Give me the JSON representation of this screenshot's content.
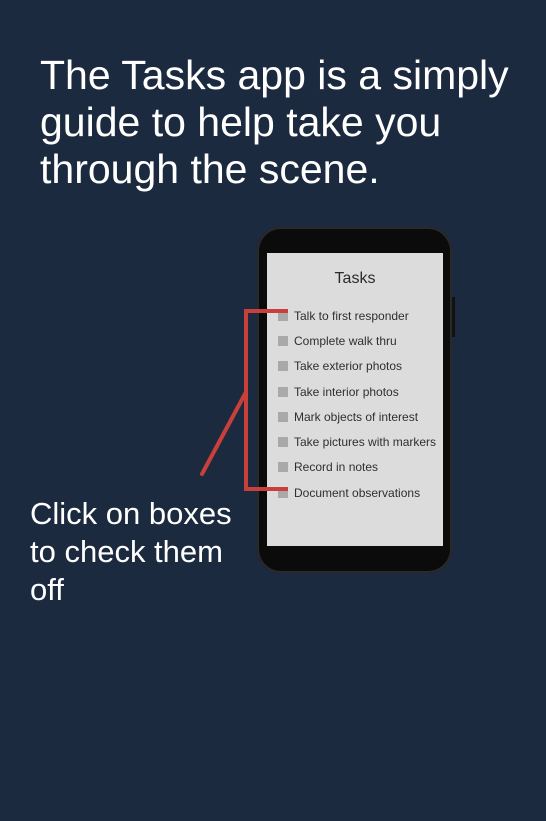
{
  "headline": "The Tasks app is a simply guide to help take you through the scene.",
  "phone": {
    "screen_title": "Tasks",
    "tasks": [
      {
        "label": "Talk to first responder"
      },
      {
        "label": "Complete walk thru"
      },
      {
        "label": "Take exterior photos"
      },
      {
        "label": "Take interior photos"
      },
      {
        "label": "Mark objects of interest"
      },
      {
        "label": "Take pictures with markers"
      },
      {
        "label": "Record in notes"
      },
      {
        "label": "Document observations"
      }
    ]
  },
  "callout": "Click on boxes to check them off",
  "colors": {
    "background": "#1c2a3f",
    "annotation": "#c9403a",
    "screen": "#dcdcdc",
    "checkbox": "#a9a9a9"
  }
}
